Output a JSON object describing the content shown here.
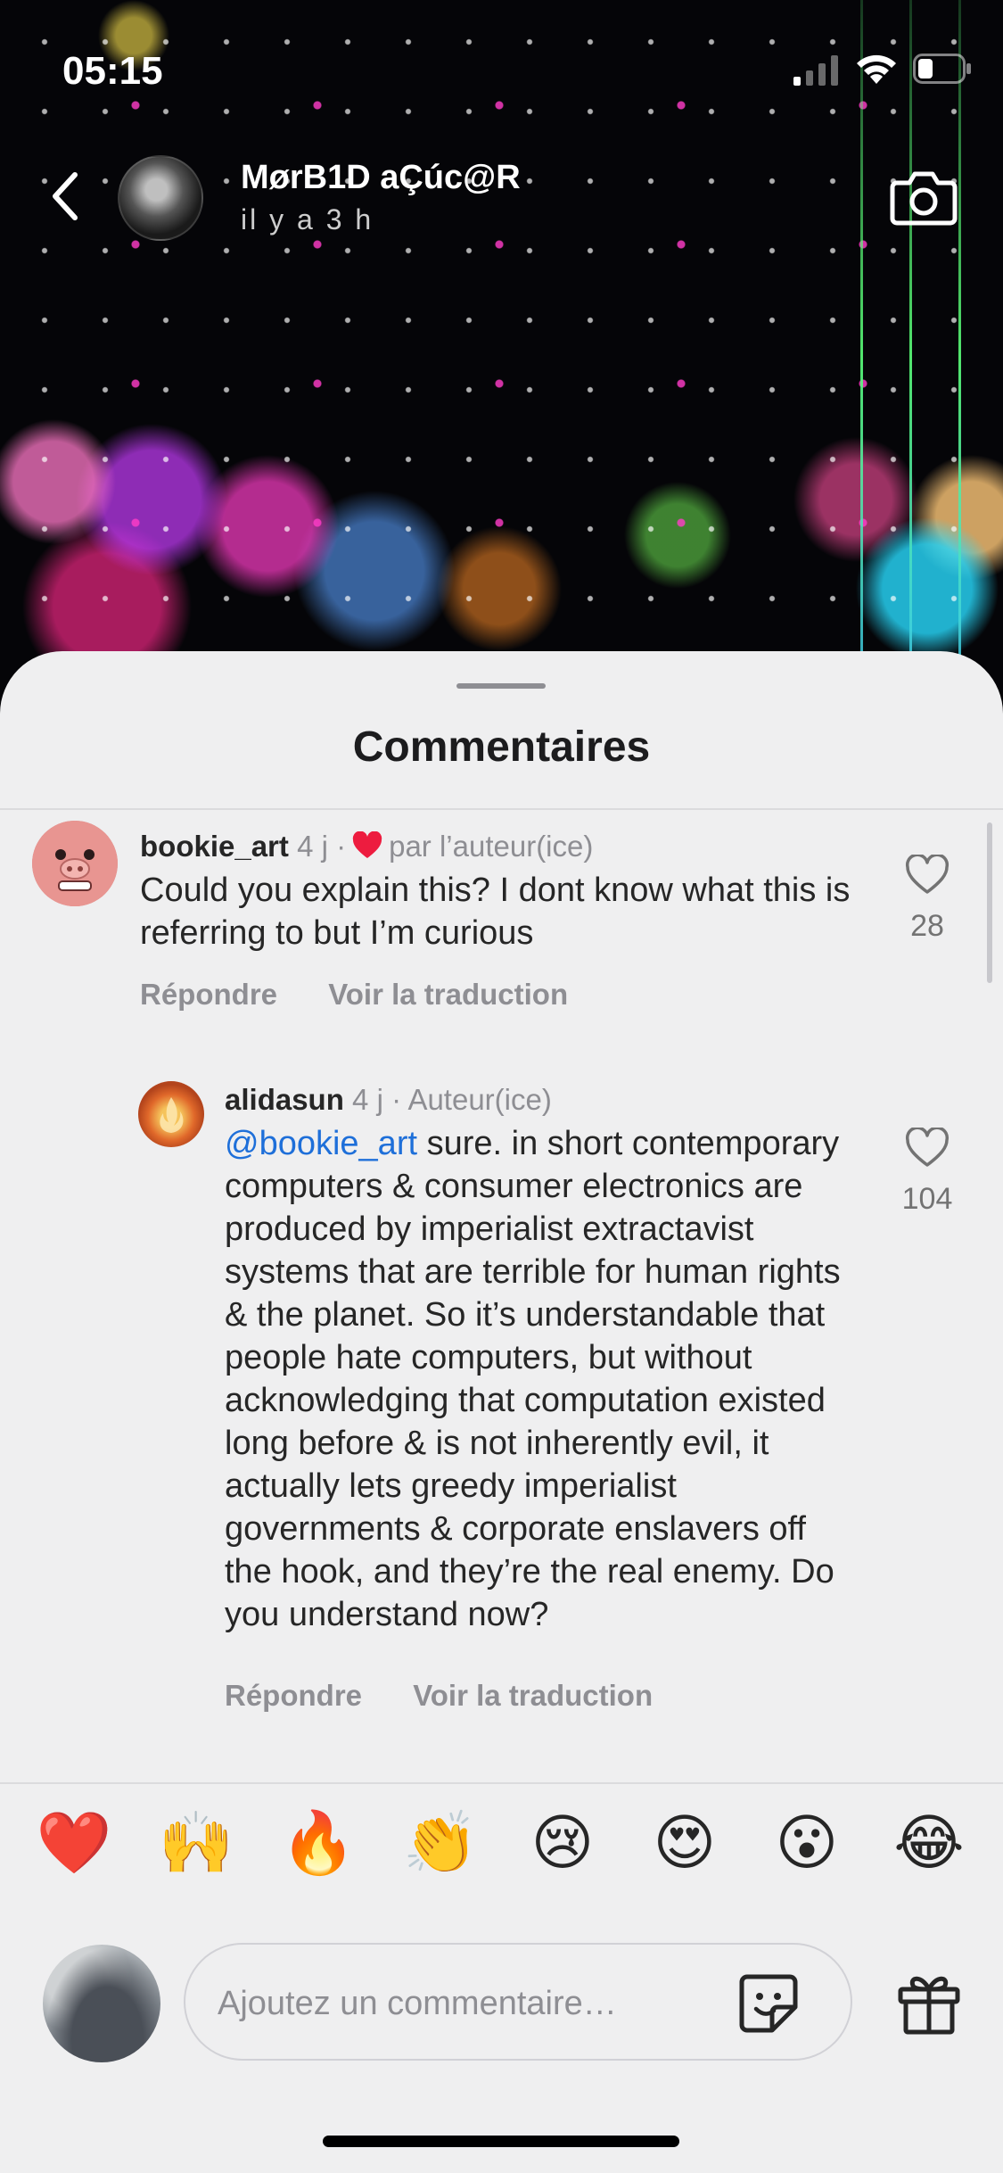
{
  "status_bar": {
    "time": "05:15"
  },
  "story": {
    "username": "MørB1D aÇúc@R",
    "posted_ago": "il y a 3 h"
  },
  "sheet": {
    "title": "Commentaires"
  },
  "comments": [
    {
      "username": "bookie_art",
      "age": "4 j",
      "liked_by_author_label": "par l’auteur(ice)",
      "text": "Could you explain this? I dont know what this is referring to but I’m curious",
      "like_count": "28",
      "reply_label": "Répondre",
      "translate_label": "Voir la traduction"
    },
    {
      "username": "alidasun",
      "age": "4 j",
      "author_label": "Auteur(ice)",
      "mention": "@bookie_art",
      "text": "sure. in short contemporary computers & consumer electronics are produced by imperialist extractavist systems that are terrible for human rights & the planet. So it’s understandable that people hate computers, but without acknowledging that computation existed long before & is not inherently evil, it actually lets greedy imperialist governments & corporate enslavers off the hook, and they’re the real enemy. Do you understand now?",
      "like_count": "104",
      "reply_label": "Répondre",
      "translate_label": "Voir la traduction"
    }
  ],
  "emoji_reactions": [
    "❤️",
    "🙌",
    "🔥",
    "👏",
    "😢",
    "😍",
    "😮",
    "😂"
  ],
  "comment_input": {
    "placeholder": "Ajoutez un commentaire…"
  },
  "colors": {
    "sheet_bg": "#efeff0",
    "heart_red": "#ed1c3f",
    "mention_blue": "#1e6fd9",
    "muted_text": "#8e8e93"
  }
}
